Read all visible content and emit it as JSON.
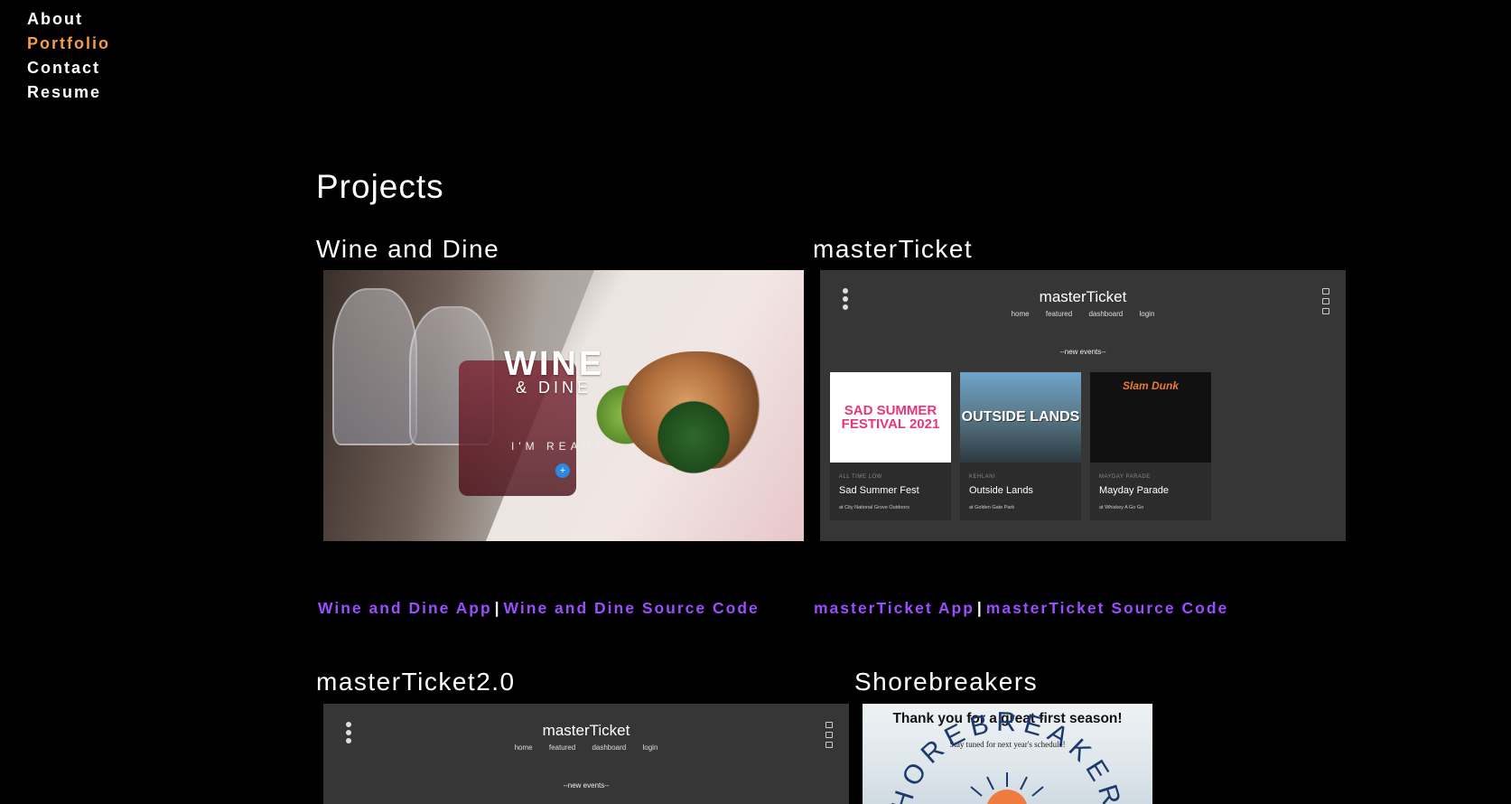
{
  "nav": {
    "items": [
      {
        "label": "About"
      },
      {
        "label": "Portfolio"
      },
      {
        "label": "Contact"
      },
      {
        "label": "Resume"
      }
    ]
  },
  "section": {
    "title": "Projects"
  },
  "projects": [
    {
      "title": "Wine and Dine",
      "app_link": "Wine and Dine App",
      "source_link": "Wine and Dine Source Code",
      "separator": "|",
      "thumb": {
        "logo_big": "WINE",
        "logo_small": "& DINE",
        "cta": "I'M READY!",
        "cta_icon": "+"
      }
    },
    {
      "title": "masterTicket",
      "app_link": "masterTicket App",
      "source_link": "masterTicket Source Code",
      "separator": "|"
    },
    {
      "title": "masterTicket2.0"
    },
    {
      "title": "Shorebreakers",
      "thumb": {
        "headline": "Thank you for a great first season!",
        "subline": "Stay tuned for next year's schedule!",
        "logo_text": "SHOREBREAKERS"
      }
    }
  ],
  "mt_mock": {
    "brand": "masterTicket",
    "nav": [
      "home",
      "featured",
      "dashboard",
      "login"
    ],
    "subtitle": "--new events--",
    "cards": [
      {
        "tag": "ALL TIME LOW",
        "name": "Sad Summer Fest",
        "venue": "at City National Grove Outdoors",
        "img_text": "SAD SUMMER FESTIVAL 2021"
      },
      {
        "tag": "KEHLANI",
        "name": "Outside Lands",
        "venue": "at Golden Gate Park",
        "img_text": "OUTSIDE LANDS"
      },
      {
        "tag": "MAYDAY PARADE",
        "name": "Mayday Parade",
        "venue": "at Whiskey A Go Go",
        "img_text": "Slam Dunk"
      }
    ]
  },
  "colors": {
    "background": "#000000",
    "nav_active": "#f39c4a",
    "link": "#9b4dff",
    "text": "#ffffff"
  }
}
